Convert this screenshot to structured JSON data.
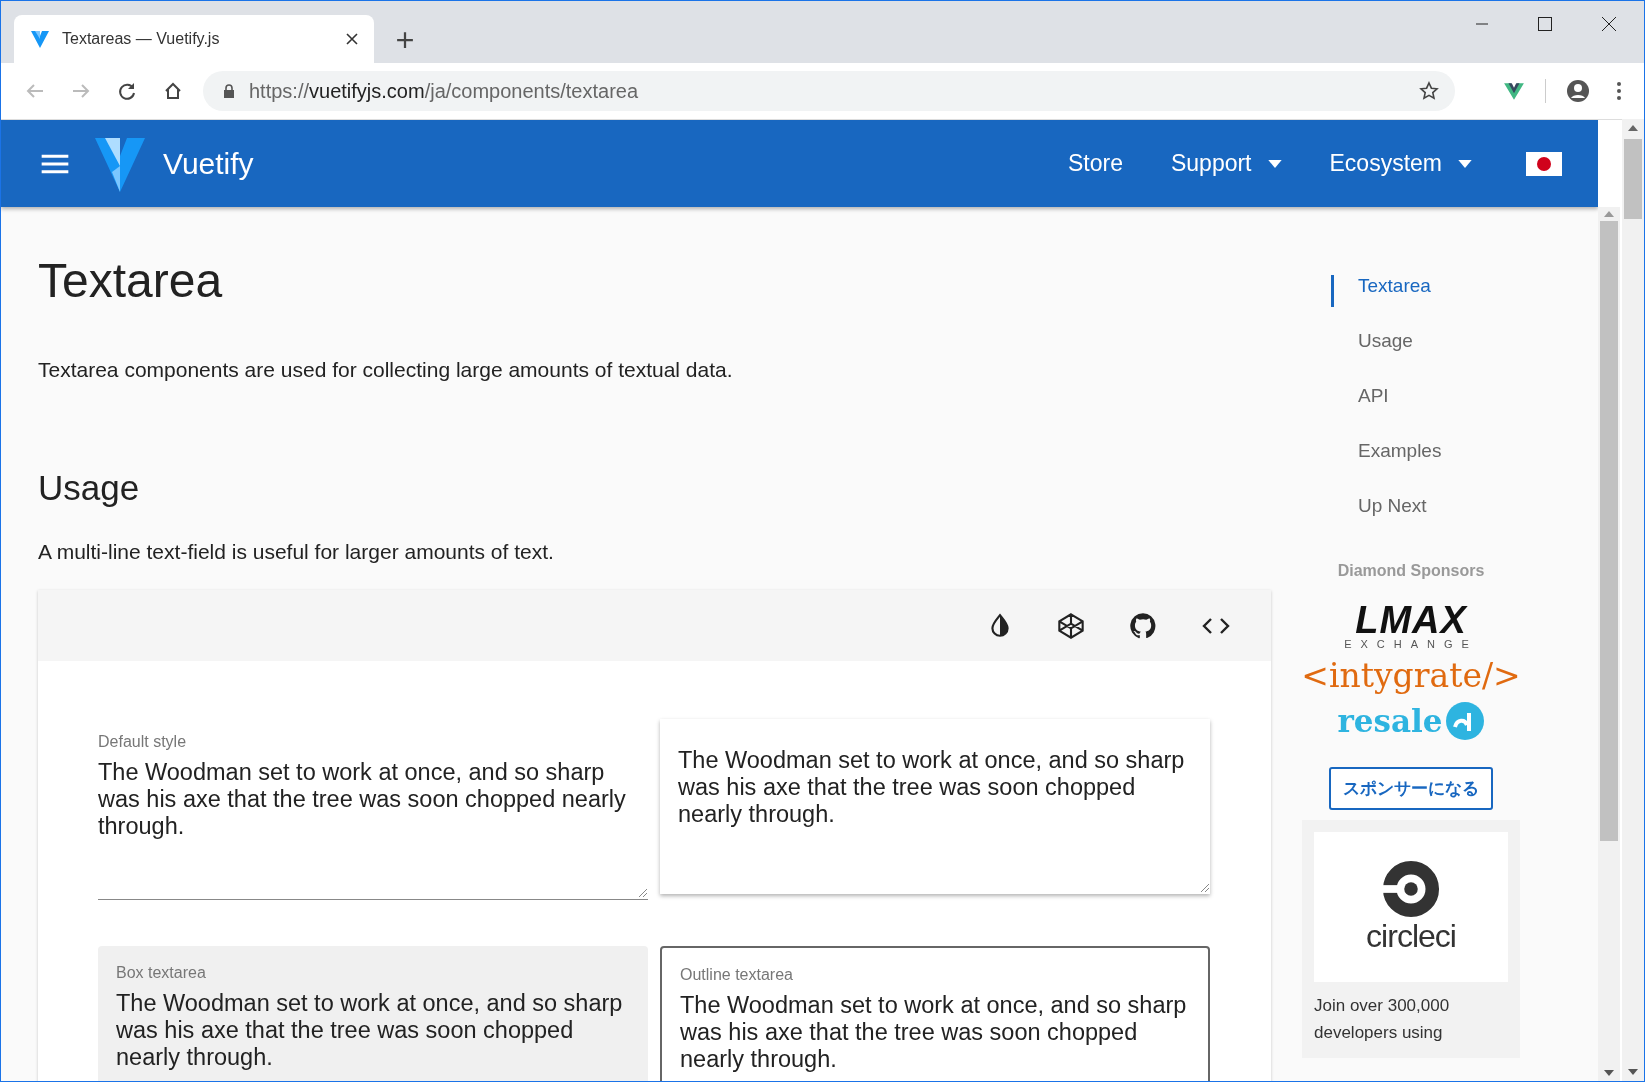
{
  "browser": {
    "tab": {
      "title": "Textareas — Vuetify.js"
    },
    "url": {
      "scheme": "https://",
      "host": "vuetifyjs.com",
      "path": "/ja/components/textarea"
    }
  },
  "app_bar": {
    "brand": "Vuetify",
    "nav": [
      {
        "label": "Store",
        "dropdown": false
      },
      {
        "label": "Support",
        "dropdown": true
      },
      {
        "label": "Ecosystem",
        "dropdown": true
      }
    ]
  },
  "page": {
    "title": "Textarea",
    "description": "Textarea components are used for collecting large amounts of textual data.",
    "section": "Usage",
    "section_text": "A multi-line text-field is useful for larger amounts of text."
  },
  "example": {
    "textareas": [
      {
        "kind": "underlined",
        "label": "Default style",
        "value": "The Woodman set to work at once, and so sharp was his axe that the tree was soon chopped nearly through."
      },
      {
        "kind": "solo",
        "value": "The Woodman set to work at once, and so sharp was his axe that the tree was soon chopped nearly through."
      },
      {
        "kind": "filled",
        "label": "Box textarea",
        "value": "The Woodman set to work at once, and so sharp was his axe that the tree was soon chopped nearly through."
      },
      {
        "kind": "outlined",
        "label": "Outline textarea",
        "value": "The Woodman set to work at once, and so sharp was his axe that the tree was soon chopped nearly through."
      }
    ]
  },
  "toc": [
    {
      "label": "Textarea",
      "selected": true
    },
    {
      "label": "Usage",
      "selected": false
    },
    {
      "label": "API",
      "selected": false
    },
    {
      "label": "Examples",
      "selected": false
    },
    {
      "label": "Up Next",
      "selected": false
    }
  ],
  "sponsors": {
    "heading": "Diamond Sponsors",
    "lmax": {
      "name": "LMAX",
      "sub": "EXCHANGE"
    },
    "intygrate": "<intygrate/>",
    "resale": "resale",
    "button": "スポンサーになる"
  },
  "promo": {
    "logo": "circleci",
    "text": "Join over 300,000 developers using"
  }
}
